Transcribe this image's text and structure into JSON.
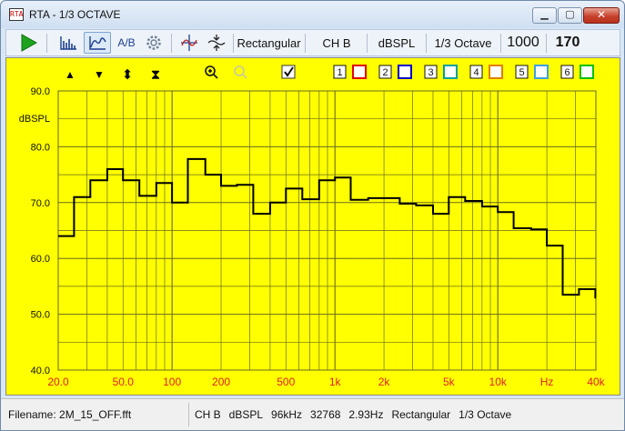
{
  "window": {
    "title": "RTA - 1/3 OCTAVE",
    "icon_text": "RTA",
    "minimize_glyph": "▁",
    "maximize_glyph": "▢",
    "close_glyph": "✕"
  },
  "toolbar": {
    "icons": [
      "play-icon",
      "spectrum-bars-icon",
      "curve-icon",
      "gear-icon",
      "cursor-crosshair-icon",
      "tune-icon"
    ],
    "ab_label": "A/B",
    "window_type": "Rectangular",
    "channel": "CH B",
    "units": "dBSPL",
    "resolution": "1/3 Octave",
    "value1": "1000",
    "value2": "170"
  },
  "plot_toolbar": {
    "arrow_up": "▲",
    "arrow_down": "▼",
    "expand": "⬍",
    "collapse": "⧗",
    "zoom_in": "⊕",
    "zoom_out": "⊖",
    "checkbox_checked": true,
    "traces": [
      {
        "number": "1",
        "color": "#e00000"
      },
      {
        "number": "2",
        "color": "#0000c8"
      },
      {
        "number": "3",
        "color": "#00a0a0"
      },
      {
        "number": "4",
        "color": "#e08000"
      },
      {
        "number": "5",
        "color": "#40a0e0"
      },
      {
        "number": "6",
        "color": "#00c000"
      }
    ]
  },
  "chart_data": {
    "type": "line",
    "title": "",
    "xlabel": "",
    "ylabel": "dBSPL",
    "x_scale": "log",
    "xlim": [
      20,
      40000
    ],
    "ylim": [
      40,
      90
    ],
    "y_ticks": [
      "90.0",
      "80.0",
      "70.0",
      "60.0",
      "50.0",
      "40.0"
    ],
    "x_tick_labels": [
      {
        "value": 20,
        "label": "20.0"
      },
      {
        "value": 50,
        "label": "50.0"
      },
      {
        "value": 100,
        "label": "100"
      },
      {
        "value": 200,
        "label": "200"
      },
      {
        "value": 500,
        "label": "500"
      },
      {
        "value": 1000,
        "label": "1k"
      },
      {
        "value": 2000,
        "label": "2k"
      },
      {
        "value": 5000,
        "label": "5k"
      },
      {
        "value": 10000,
        "label": "10k"
      },
      {
        "value": 20000,
        "label": "Hz"
      },
      {
        "value": 40000,
        "label": "40k"
      }
    ],
    "grid": true,
    "line_color": "#000000",
    "background_color": "#ffff00",
    "series": [
      {
        "bands": [
          20,
          25,
          31.5,
          40,
          50,
          63,
          80,
          100,
          125,
          160,
          200,
          250,
          315,
          400,
          500,
          630,
          800,
          1000,
          1250,
          1600,
          2000,
          2500,
          3150,
          4000,
          5000,
          6300,
          8000,
          10000,
          12500,
          16000,
          20000,
          25000
        ],
        "values": [
          64.0,
          71.0,
          74.0,
          76.0,
          74.0,
          71.2,
          73.5,
          70.0,
          77.8,
          75.0,
          73.0,
          73.2,
          68.0,
          70.0,
          72.5,
          70.6,
          74.0,
          74.5,
          70.5,
          70.8,
          70.8,
          69.8,
          69.5,
          68.0,
          71.0,
          70.3,
          69.3,
          68.3,
          65.4,
          65.2,
          62.3,
          53.5,
          54.5,
          53.0
        ]
      }
    ]
  },
  "statusbar": {
    "filename_label": "Filename: 2M_15_OFF.fft",
    "channel": "CH B",
    "units": "dBSPL",
    "sample_rate": "96kHz",
    "fft_size": "32768",
    "bin_width": "2.93Hz",
    "window_type": "Rectangular",
    "resolution": "1/3 Octave"
  }
}
